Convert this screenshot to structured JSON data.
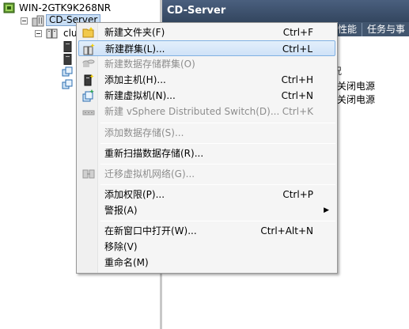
{
  "tree": {
    "root_label": "WIN-2GTK9K268NR",
    "datacenter_label": "CD-Server",
    "cluster_label": "clu"
  },
  "right_pane": {
    "title": "CD-Server",
    "tabs": [
      "性能",
      "任务与事"
    ],
    "column_header": "况",
    "rows": [
      "关闭电源",
      "关闭电源"
    ]
  },
  "menu": {
    "items": [
      {
        "label": "新建文件夹(F)",
        "shortcut": "Ctrl+F",
        "enabled": true,
        "icon": "new-folder-icon"
      },
      {
        "label": "新建群集(L)...",
        "shortcut": "Ctrl+L",
        "enabled": true,
        "highlighted": true,
        "icon": "new-cluster-icon"
      },
      {
        "label": "新建数据存储群集(O)",
        "shortcut": "",
        "enabled": false,
        "icon": "datastore-cluster-icon"
      },
      {
        "label": "添加主机(H)...",
        "shortcut": "Ctrl+H",
        "enabled": true,
        "icon": "add-host-icon"
      },
      {
        "label": "新建虚拟机(N)...",
        "shortcut": "Ctrl+N",
        "enabled": true,
        "icon": "new-vm-icon"
      },
      {
        "label": "新建 vSphere Distributed Switch(D)...",
        "shortcut": "Ctrl+K",
        "enabled": false,
        "icon": "distributed-switch-icon"
      },
      {
        "label": "添加数据存储(S)...",
        "shortcut": "",
        "enabled": false
      },
      {
        "label": "重新扫描数据存储(R)...",
        "shortcut": "",
        "enabled": true
      },
      {
        "label": "迁移虚拟机网络(G)...",
        "shortcut": "",
        "enabled": false,
        "icon": "migrate-network-icon"
      },
      {
        "label": "添加权限(P)...",
        "shortcut": "Ctrl+P",
        "enabled": true
      },
      {
        "label": "警报(A)",
        "shortcut": "",
        "enabled": true,
        "submenu": true
      },
      {
        "label": "在新窗口中打开(W)...",
        "shortcut": "Ctrl+Alt+N",
        "enabled": true
      },
      {
        "label": "移除(V)",
        "shortcut": "",
        "enabled": true
      },
      {
        "label": "重命名(M)",
        "shortcut": "",
        "enabled": true
      }
    ]
  },
  "colors": {
    "header_bg": "#3d516c",
    "highlight": "#cfe2f7",
    "disabled_text": "#8d8d8d"
  }
}
